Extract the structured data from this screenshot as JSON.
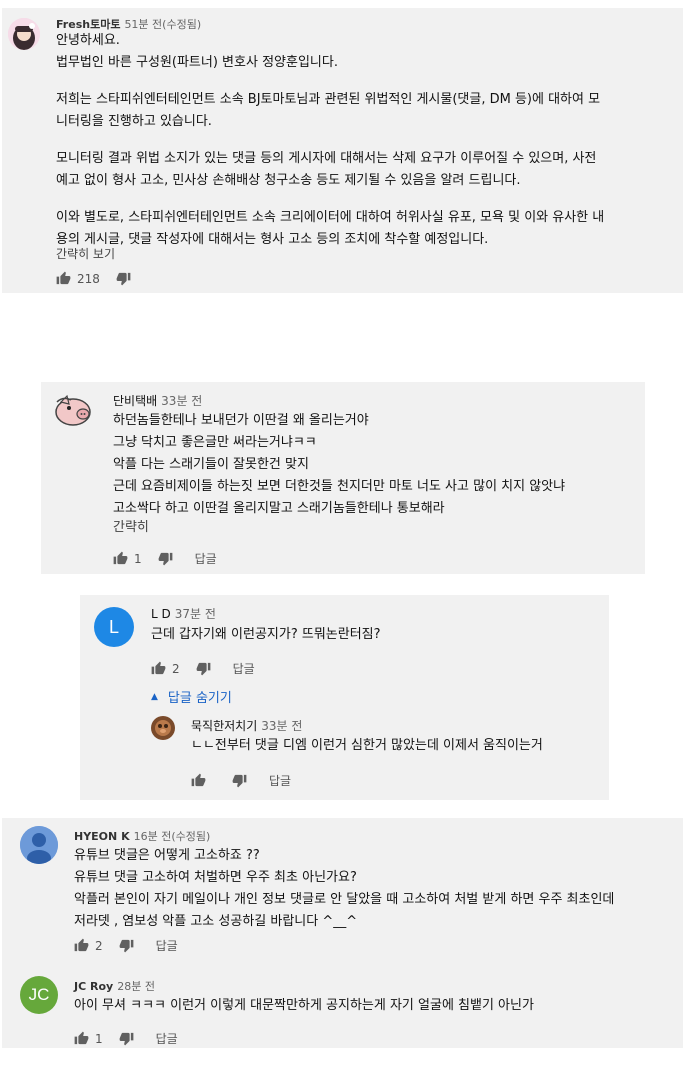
{
  "comments": [
    {
      "author": "Fresh토마토",
      "timestamp": "51분 전(수정됨)",
      "lines": [
        "안녕하세요.",
        "법무법인 바른 구성원(파트너) 변호사 정양훈입니다.",
        "",
        "저희는 스타피쉬엔터테인먼트 소속 BJ토마토님과 관련된 위법적인 게시물(댓글, DM 등)에 대하여 모",
        "니터링을 진행하고 있습니다.",
        "",
        "모니터링 결과 위법 소지가 있는 댓글 등의 게시자에 대해서는 삭제 요구가 이루어질 수 있으며, 사전",
        "예고 없이 형사 고소, 민사상 손해배상 청구소송 등도 제기될 수 있음을 알려 드립니다.",
        "",
        "이와 별도로, 스타피쉬엔터테인먼트 소속 크리에이터에 대하여 허위사실 유포, 모욕 및 이와 유사한 내",
        "용의 게시글, 댓글 작성자에 대해서는 형사 고소 등의 조치에 착수할 예정입니다."
      ],
      "toggle": "간략히 보기",
      "likes": "218"
    },
    {
      "author": "단비택배",
      "timestamp": "33분 전",
      "lines": [
        "하던놈들한테나 보내던가 이딴걸 왜 올리는거야",
        "그냥 닥치고 좋은글만 써라는거냐ㅋㅋ",
        "악플 다는 스래기들이 잘못한건 맞지",
        "근데 요즘비제이들 하는짓 보면 더한것들 천지더만  마토 너도 사고 많이 치지 않앗냐",
        "고소싹다 하고 이딴걸 올리지말고 스래기놈들한테나 통보해라"
      ],
      "toggle": "간략히",
      "likes": "1",
      "reply_label": "답글"
    },
    {
      "author": "L D",
      "timestamp": "37분 전",
      "avatar_letter": "L",
      "lines": [
        "근데 갑자기왜 이런공지가? 뜨뭐논란터짐?"
      ],
      "likes": "2",
      "reply_label": "답글",
      "hide_replies": "답글 숨기기"
    },
    {
      "author": "묵직한저치기",
      "timestamp": "33분 전",
      "lines": [
        "ㄴㄴ전부터 댓글 디엠 이런거 심한거 많았는데 이제서 움직이는거"
      ],
      "likes": "",
      "reply_label": "답글"
    },
    {
      "author": "HYEON K",
      "timestamp": "16분 전(수정됨)",
      "lines": [
        "유튜브 댓글은 어떻게 고소하죠 ??",
        "유튜브 댓글 고소하여 처벌하면 우주 최초 아닌가요?",
        "악플러 본인이 자기 메일이나 개인 정보 댓글로 안 달았을 때 고소하여 처벌 받게 하면 우주 최초인데",
        "저라뎃 , 염보성 악플 고소 성공하길 바랍니다 ^__^"
      ],
      "likes": "2",
      "reply_label": "답글"
    },
    {
      "author": "JC Roy",
      "timestamp": "28분 전",
      "avatar_letter": "JC",
      "lines": [
        "아이 무셔 ㅋㅋㅋ 이런거 이렇게 대문짝만하게 공지하는게 자기 얼굴에 침뱉기 아닌가"
      ],
      "likes": "1",
      "reply_label": "답글"
    }
  ],
  "colors": {
    "panel_bg": "#f1f1f1",
    "link_blue": "#1a63c6",
    "avatar_ld": "#1e88e5",
    "avatar_jc": "#66a83b",
    "avatar_hyeon": "#6d9ad9"
  },
  "icons": [
    "thumbs-up-icon",
    "thumbs-down-icon",
    "chevron-up-icon"
  ]
}
